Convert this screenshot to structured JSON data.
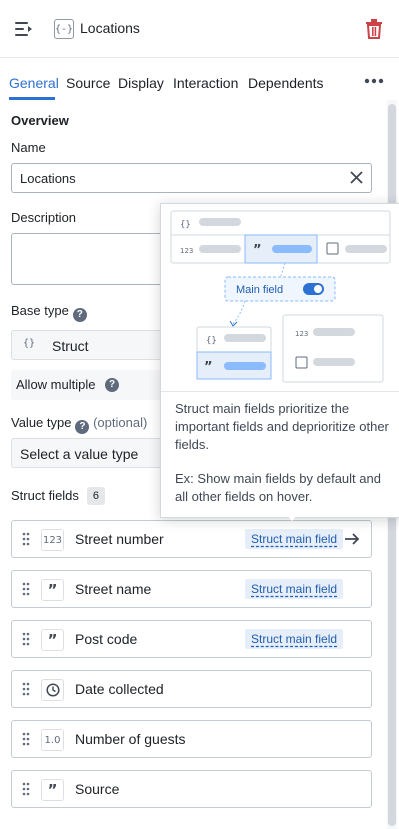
{
  "header": {
    "struct_badge": "{-}",
    "title": "Locations",
    "icons": [
      "collapse-menu-icon",
      "trash-icon"
    ]
  },
  "tabs": [
    {
      "label": "General",
      "active": true
    },
    {
      "label": "Source",
      "active": false
    },
    {
      "label": "Display",
      "active": false
    },
    {
      "label": "Interaction",
      "active": false
    },
    {
      "label": "Dependents",
      "active": false
    }
  ],
  "overview": {
    "section_title": "Overview",
    "name_label": "Name",
    "name_value": "Locations",
    "description_label": "Description",
    "description_value": "",
    "base_type_label": "Base type",
    "base_type_icon": "{}",
    "base_type_value": "Struct",
    "allow_multiple_label": "Allow multiple",
    "value_type_label": "Value type",
    "value_type_optional": "(optional)",
    "value_type_placeholder": "Select a value type"
  },
  "struct_fields": {
    "title": "Struct fields",
    "count": "6",
    "main_field_tag": "Struct main field",
    "items": [
      {
        "name": "Street number",
        "type_icon": "123",
        "main": true,
        "has_arrow": true
      },
      {
        "name": "Street name",
        "type_icon": "99",
        "main": true,
        "has_arrow": false
      },
      {
        "name": "Post code",
        "type_icon": "99",
        "main": true,
        "has_arrow": false
      },
      {
        "name": "Date collected",
        "type_icon": "clock",
        "main": false,
        "has_arrow": false
      },
      {
        "name": "Number of guests",
        "type_icon": "1.0",
        "main": false,
        "has_arrow": false
      },
      {
        "name": "Source",
        "type_icon": "99",
        "main": false,
        "has_arrow": false
      }
    ]
  },
  "popover": {
    "main_field_label": "Main field",
    "illustration_labels": {
      "struct": "{}",
      "number": "123"
    },
    "description": "Struct main fields prioritize the important fields and deprioritize other fields.",
    "example": "Ex: Show main fields by default and all other fields on hover."
  },
  "colors": {
    "accent": "#2d72d2",
    "danger": "#cd4246",
    "tag_bg": "#e6eef9"
  }
}
